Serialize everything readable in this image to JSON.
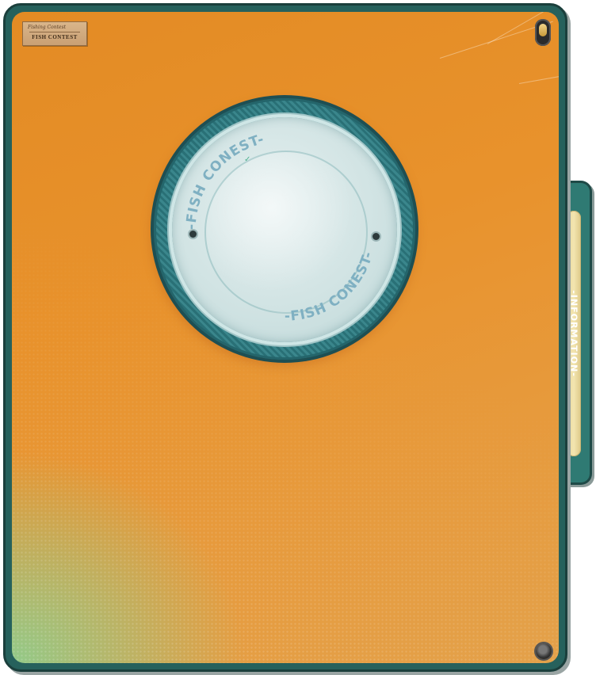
{
  "panel": {
    "label_sticker": {
      "subtitle": "Fishing Contest",
      "title": "FISH CONTEST"
    },
    "porthole": {
      "ring_text_top": "-FISH CONEST-",
      "ring_text_bottom": "-FISH CONEST-"
    },
    "side_tab": {
      "label": "-INFORMATION-"
    }
  },
  "colors": {
    "folder_orange": "#e38b24",
    "folder_border": "#26615c",
    "tab_teal": "#2f7a73",
    "porthole_ring": "#2f7f86",
    "glass": "#cfe2e2",
    "accent_green": "#84d296"
  },
  "icons": {
    "toggle": "toggle-switch-icon",
    "screw": "screw-icon",
    "bolt": "bolt-icon"
  }
}
